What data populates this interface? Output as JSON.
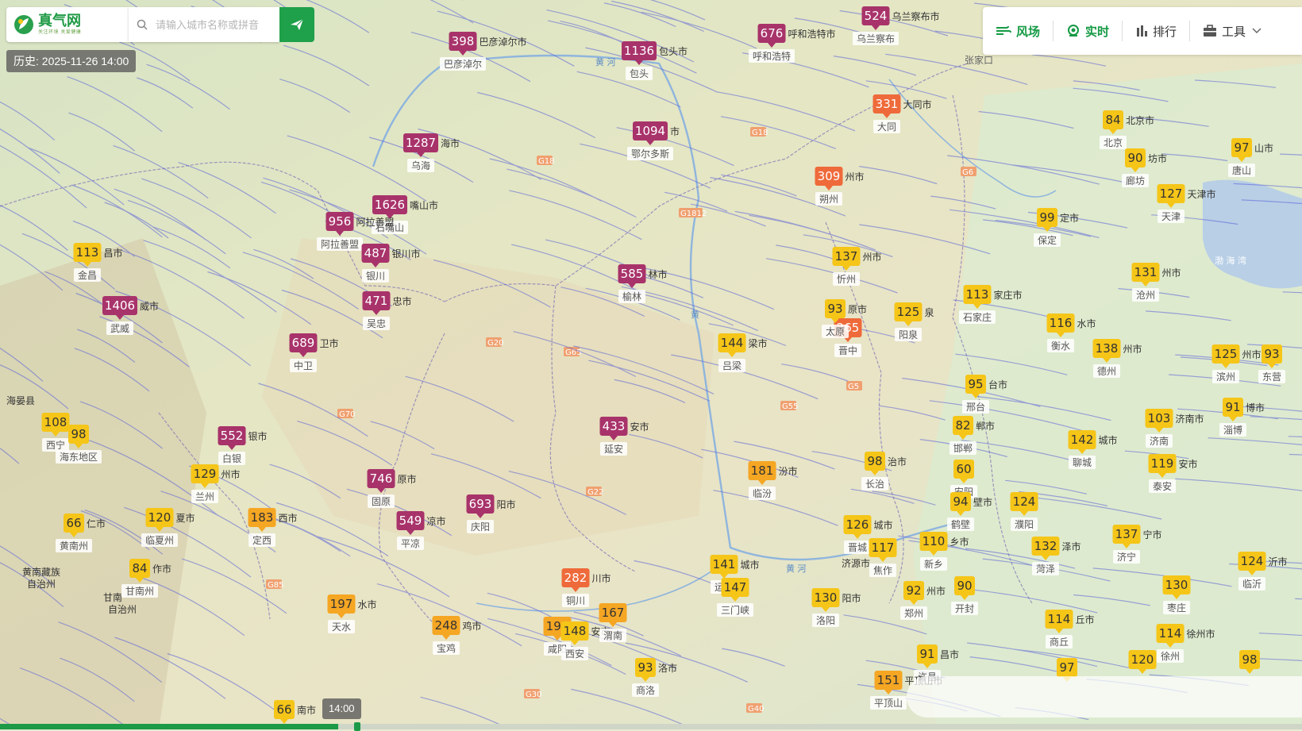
{
  "header": {
    "logo_title": "真气网",
    "logo_slogan": "关注环境 关爱健康",
    "search_placeholder": "请输入城市名称或拼音",
    "history_label": "历史: 2025-11-26 14:00"
  },
  "toolbar": {
    "items": [
      {
        "label": "风场",
        "icon": "wind-icon",
        "active": true
      },
      {
        "label": "实时",
        "icon": "location-pin-icon",
        "active": true
      },
      {
        "label": "排行",
        "icon": "bar-chart-icon",
        "active": false
      },
      {
        "label": "工具",
        "icon": "toolbox-icon",
        "active": false
      }
    ]
  },
  "timeline": {
    "time_label": "14:00",
    "progress": 0.26
  },
  "colors": {
    "aqi_good": "#f5c518",
    "aqi_moderate": "#f5a623",
    "aqi_unhealthy": "#ef6a3a",
    "aqi_very_unhealthy": "#a8336a",
    "brand_green": "#1fa04a",
    "wind_line": "#5b63d8"
  },
  "stations": [
    {
      "aqi": "398",
      "city": "巴彦淖尔",
      "label": "巴彦淖尔市",
      "level": "vu"
    },
    {
      "aqi": "1136",
      "city": "包头",
      "label": "包头市",
      "level": "vu"
    },
    {
      "aqi": "676",
      "city": "呼和浩特",
      "label": "呼和浩特市",
      "level": "vu"
    },
    {
      "aqi": "524",
      "city": "乌兰察布",
      "label": "乌兰察布市",
      "level": "vu"
    },
    {
      "aqi": "1094",
      "city": "鄂尔多斯",
      "label": "市",
      "level": "vu"
    },
    {
      "aqi": "1287",
      "city": "乌海",
      "label": "海市",
      "level": "vu"
    },
    {
      "aqi": "1626",
      "city": "石嘴山",
      "label": "嘴山市",
      "level": "vu"
    },
    {
      "aqi": "956",
      "city": "阿拉善盟",
      "label": "阿拉善盟",
      "level": "vu"
    },
    {
      "aqi": "487",
      "city": "银川",
      "label": "银川市",
      "level": "vu"
    },
    {
      "aqi": "471",
      "city": "吴忠",
      "label": "忠市",
      "level": "vu"
    },
    {
      "aqi": "585",
      "city": "榆林",
      "label": "林市",
      "level": "vu"
    },
    {
      "aqi": "1406",
      "city": "武威",
      "label": "威市",
      "level": "vu"
    },
    {
      "aqi": "689",
      "city": "中卫",
      "label": "卫市",
      "level": "vu"
    },
    {
      "aqi": "113",
      "city": "金昌",
      "label": "昌市",
      "level": "good"
    },
    {
      "aqi": "433",
      "city": "延安",
      "label": "安市",
      "level": "vu"
    },
    {
      "aqi": "552",
      "city": "白银",
      "label": "银市",
      "level": "vu"
    },
    {
      "aqi": "746",
      "city": "固原",
      "label": "原市",
      "level": "vu"
    },
    {
      "aqi": "693",
      "city": "庆阳",
      "label": "阳市",
      "level": "vu"
    },
    {
      "aqi": "549",
      "city": "平凉",
      "label": "凉市",
      "level": "vu"
    },
    {
      "aqi": "331",
      "city": "大同",
      "label": "大同市",
      "level": "u"
    },
    {
      "aqi": "309",
      "city": "朔州",
      "label": "州市",
      "level": "u"
    },
    {
      "aqi": "265",
      "city": "晋中",
      "label": "",
      "level": "u"
    },
    {
      "aqi": "282",
      "city": "铜川",
      "label": "川市",
      "level": "u"
    },
    {
      "aqi": "84",
      "city": "北京",
      "label": "北京市",
      "level": "good"
    },
    {
      "aqi": "90",
      "city": "廊坊",
      "label": "坊市",
      "level": "good"
    },
    {
      "aqi": "97",
      "city": "唐山",
      "label": "山市",
      "level": "good"
    },
    {
      "aqi": "127",
      "city": "天津",
      "label": "天津市",
      "level": "good"
    },
    {
      "aqi": "99",
      "city": "保定",
      "label": "定市",
      "level": "good"
    },
    {
      "aqi": "137",
      "city": "忻州",
      "label": "州市",
      "level": "good"
    },
    {
      "aqi": "131",
      "city": "沧州",
      "label": "州市",
      "level": "good"
    },
    {
      "aqi": "113",
      "city": "石家庄",
      "label": "家庄市",
      "level": "good"
    },
    {
      "aqi": "93",
      "city": "太原",
      "label": "原市",
      "level": "good"
    },
    {
      "aqi": "125",
      "city": "阳泉",
      "label": "泉",
      "level": "good"
    },
    {
      "aqi": "116",
      "city": "衡水",
      "label": "水市",
      "level": "good"
    },
    {
      "aqi": "138",
      "city": "德州",
      "label": "州市",
      "level": "good"
    },
    {
      "aqi": "125",
      "city": "滨州",
      "label": "州市",
      "level": "good"
    },
    {
      "aqi": "93",
      "city": "东营",
      "label": "",
      "level": "good"
    },
    {
      "aqi": "144",
      "city": "吕梁",
      "label": "梁市",
      "level": "good"
    },
    {
      "aqi": "95",
      "city": "邢台",
      "label": "台市",
      "level": "good"
    },
    {
      "aqi": "91",
      "city": "淄博",
      "label": "博市",
      "level": "good"
    },
    {
      "aqi": "103",
      "city": "济南",
      "label": "济南市",
      "level": "good"
    },
    {
      "aqi": "82",
      "city": "邯郸",
      "label": "郸市",
      "level": "good"
    },
    {
      "aqi": "142",
      "city": "聊城",
      "label": "城市",
      "level": "good"
    },
    {
      "aqi": "108",
      "city": "西宁",
      "label": "",
      "level": "good"
    },
    {
      "aqi": "98",
      "city": "海东地区",
      "label": "",
      "level": "good"
    },
    {
      "aqi": "98",
      "city": "长治",
      "label": "治市",
      "level": "good"
    },
    {
      "aqi": "181",
      "city": "临汾",
      "label": "汾市",
      "level": "mod"
    },
    {
      "aqi": "60",
      "city": "安阳",
      "label": "",
      "level": "good"
    },
    {
      "aqi": "119",
      "city": "泰安",
      "label": "安市",
      "level": "good"
    },
    {
      "aqi": "129",
      "city": "兰州",
      "label": "州市",
      "level": "good"
    },
    {
      "aqi": "94",
      "city": "鹤壁",
      "label": "壁市",
      "level": "good"
    },
    {
      "aqi": "124",
      "city": "濮阳",
      "label": "",
      "level": "good"
    },
    {
      "aqi": "66",
      "city": "黄南州",
      "label": "仁市",
      "level": "good"
    },
    {
      "aqi": "120",
      "city": "临夏州",
      "label": "夏市",
      "level": "good"
    },
    {
      "aqi": "183",
      "city": "定西",
      "label": "西市",
      "level": "mod"
    },
    {
      "aqi": "126",
      "city": "晋城",
      "label": "城市",
      "level": "good"
    },
    {
      "aqi": "117",
      "city": "焦作",
      "label": "",
      "level": "good"
    },
    {
      "aqi": "137",
      "city": "济宁",
      "label": "宁市",
      "level": "good"
    },
    {
      "aqi": "110",
      "city": "新乡",
      "label": "乡市",
      "level": "good"
    },
    {
      "aqi": "132",
      "city": "菏泽",
      "label": "泽市",
      "level": "good"
    },
    {
      "aqi": "124",
      "city": "临沂",
      "label": "沂市",
      "level": "good"
    },
    {
      "aqi": "84",
      "city": "甘南州",
      "label": "作市",
      "level": "good"
    },
    {
      "aqi": "141",
      "city": "运城",
      "label": "城市",
      "level": "good"
    },
    {
      "aqi": "147",
      "city": "三门峡",
      "label": "",
      "level": "good"
    },
    {
      "aqi": "92",
      "city": "郑州",
      "label": "州市",
      "level": "good"
    },
    {
      "aqi": "90",
      "city": "开封",
      "label": "",
      "level": "good"
    },
    {
      "aqi": "130",
      "city": "洛阳",
      "label": "阳市",
      "level": "good"
    },
    {
      "aqi": "130",
      "city": "枣庄",
      "label": "",
      "level": "good"
    },
    {
      "aqi": "197",
      "city": "天水",
      "label": "水市",
      "level": "mod"
    },
    {
      "aqi": "248",
      "city": "宝鸡",
      "label": "鸡市",
      "level": "mod"
    },
    {
      "aqi": "192",
      "city": "咸阳",
      "label": "",
      "level": "mod"
    },
    {
      "aqi": "148",
      "city": "西安",
      "label": "安市",
      "level": "good"
    },
    {
      "aqi": "167",
      "city": "渭南",
      "label": "",
      "level": "mod"
    },
    {
      "aqi": "114",
      "city": "商丘",
      "label": "丘市",
      "level": "good"
    },
    {
      "aqi": "114",
      "city": "徐州",
      "label": "徐州市",
      "level": "good"
    },
    {
      "aqi": "93",
      "city": "商洛",
      "label": "洛市",
      "level": "good"
    },
    {
      "aqi": "91",
      "city": "许昌",
      "label": "昌市",
      "level": "good"
    },
    {
      "aqi": "97",
      "city": "",
      "label": "",
      "level": "good"
    },
    {
      "aqi": "120",
      "city": "",
      "label": "",
      "level": "good"
    },
    {
      "aqi": "98",
      "city": "",
      "label": "",
      "level": "good"
    },
    {
      "aqi": "151",
      "city": "平顶山",
      "label": "平顶山市",
      "level": "mod"
    },
    {
      "aqi": "66",
      "city": "",
      "label": "南市",
      "level": "good"
    }
  ],
  "place_labels": [
    "海晏县",
    "黄南藏族自治州",
    "甘南藏族自治州",
    "张家口",
    "济源市",
    "新乡"
  ],
  "water_labels": [
    "渤海湾",
    "黄河",
    "黄河",
    "黄河"
  ],
  "road_labels": [
    "G18",
    "G18",
    "G1812",
    "G6",
    "G65",
    "G20",
    "G70",
    "G22",
    "G85",
    "G5",
    "G30",
    "G40",
    "G55"
  ]
}
